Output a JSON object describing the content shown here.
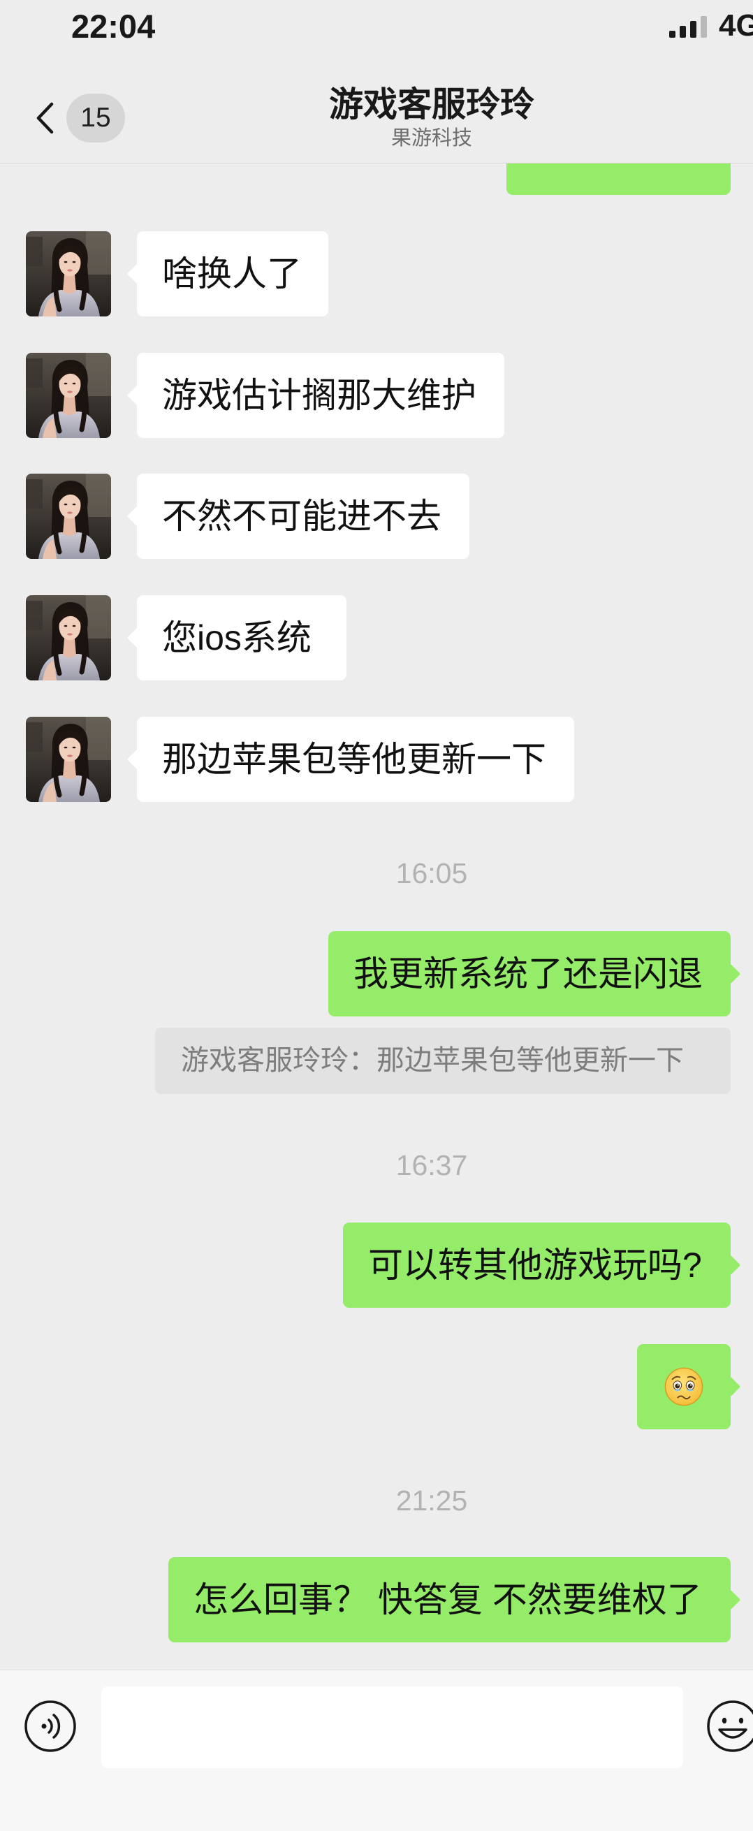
{
  "status_bar": {
    "time": "22:04",
    "signal_icon": "signal-bars-icon",
    "network": "4G"
  },
  "nav": {
    "back_icon": "chevron-left-icon",
    "unread_count": "15",
    "title": "游戏客服玲玲",
    "subtitle": "果游科技"
  },
  "chat": {
    "items": [
      {
        "text": "啥换人了",
        "outgoing": false
      },
      {
        "text": "游戏估计搁那大维护",
        "outgoing": false
      },
      {
        "text": "不然不可能进不去",
        "outgoing": false
      },
      {
        "text": "您ios系统",
        "outgoing": false
      },
      {
        "text": "那边苹果包等他更新一下",
        "outgoing": false
      },
      {
        "time": "16:05"
      },
      {
        "text": "我更新系统了还是闪退",
        "outgoing": true
      },
      {
        "quote": "游戏客服玲玲：那边苹果包等他更新一下"
      },
      {
        "time": "16:37"
      },
      {
        "text": "可以转其他游戏玩吗?",
        "outgoing": true
      },
      {
        "emoji_icon": "pleading-face-emoji",
        "outgoing": true
      },
      {
        "time": "21:25"
      },
      {
        "text": "怎么回事？ 快答复 不然要维权了",
        "outgoing": true
      }
    ]
  },
  "input_bar": {
    "voice_icon": "voice-input-icon",
    "draft_text": "",
    "emoji_icon": "emoji-smile-icon"
  },
  "theme": {
    "chat_background": "#ededed",
    "outgoing_bubble": "#95ec69",
    "incoming_bubble": "#ffffff",
    "timestamp_text": "#b2b2b2",
    "input_bar_background": "#f7f7f7"
  }
}
